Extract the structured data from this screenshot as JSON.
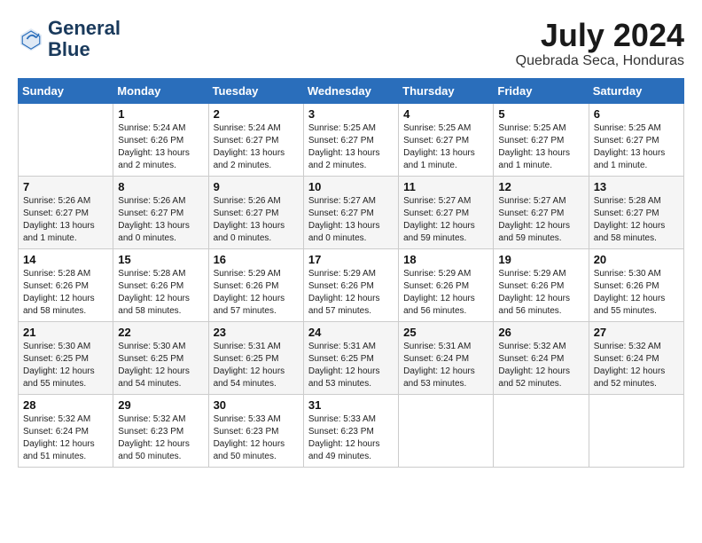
{
  "logo": {
    "line1": "General",
    "line2": "Blue"
  },
  "title": {
    "month_year": "July 2024",
    "location": "Quebrada Seca, Honduras"
  },
  "weekdays": [
    "Sunday",
    "Monday",
    "Tuesday",
    "Wednesday",
    "Thursday",
    "Friday",
    "Saturday"
  ],
  "weeks": [
    [
      {
        "day": "",
        "info": ""
      },
      {
        "day": "1",
        "info": "Sunrise: 5:24 AM\nSunset: 6:26 PM\nDaylight: 13 hours\nand 2 minutes."
      },
      {
        "day": "2",
        "info": "Sunrise: 5:24 AM\nSunset: 6:27 PM\nDaylight: 13 hours\nand 2 minutes."
      },
      {
        "day": "3",
        "info": "Sunrise: 5:25 AM\nSunset: 6:27 PM\nDaylight: 13 hours\nand 2 minutes."
      },
      {
        "day": "4",
        "info": "Sunrise: 5:25 AM\nSunset: 6:27 PM\nDaylight: 13 hours\nand 1 minute."
      },
      {
        "day": "5",
        "info": "Sunrise: 5:25 AM\nSunset: 6:27 PM\nDaylight: 13 hours\nand 1 minute."
      },
      {
        "day": "6",
        "info": "Sunrise: 5:25 AM\nSunset: 6:27 PM\nDaylight: 13 hours\nand 1 minute."
      }
    ],
    [
      {
        "day": "7",
        "info": "Sunrise: 5:26 AM\nSunset: 6:27 PM\nDaylight: 13 hours\nand 1 minute."
      },
      {
        "day": "8",
        "info": "Sunrise: 5:26 AM\nSunset: 6:27 PM\nDaylight: 13 hours\nand 0 minutes."
      },
      {
        "day": "9",
        "info": "Sunrise: 5:26 AM\nSunset: 6:27 PM\nDaylight: 13 hours\nand 0 minutes."
      },
      {
        "day": "10",
        "info": "Sunrise: 5:27 AM\nSunset: 6:27 PM\nDaylight: 13 hours\nand 0 minutes."
      },
      {
        "day": "11",
        "info": "Sunrise: 5:27 AM\nSunset: 6:27 PM\nDaylight: 12 hours\nand 59 minutes."
      },
      {
        "day": "12",
        "info": "Sunrise: 5:27 AM\nSunset: 6:27 PM\nDaylight: 12 hours\nand 59 minutes."
      },
      {
        "day": "13",
        "info": "Sunrise: 5:28 AM\nSunset: 6:27 PM\nDaylight: 12 hours\nand 58 minutes."
      }
    ],
    [
      {
        "day": "14",
        "info": "Sunrise: 5:28 AM\nSunset: 6:26 PM\nDaylight: 12 hours\nand 58 minutes."
      },
      {
        "day": "15",
        "info": "Sunrise: 5:28 AM\nSunset: 6:26 PM\nDaylight: 12 hours\nand 58 minutes."
      },
      {
        "day": "16",
        "info": "Sunrise: 5:29 AM\nSunset: 6:26 PM\nDaylight: 12 hours\nand 57 minutes."
      },
      {
        "day": "17",
        "info": "Sunrise: 5:29 AM\nSunset: 6:26 PM\nDaylight: 12 hours\nand 57 minutes."
      },
      {
        "day": "18",
        "info": "Sunrise: 5:29 AM\nSunset: 6:26 PM\nDaylight: 12 hours\nand 56 minutes."
      },
      {
        "day": "19",
        "info": "Sunrise: 5:29 AM\nSunset: 6:26 PM\nDaylight: 12 hours\nand 56 minutes."
      },
      {
        "day": "20",
        "info": "Sunrise: 5:30 AM\nSunset: 6:26 PM\nDaylight: 12 hours\nand 55 minutes."
      }
    ],
    [
      {
        "day": "21",
        "info": "Sunrise: 5:30 AM\nSunset: 6:25 PM\nDaylight: 12 hours\nand 55 minutes."
      },
      {
        "day": "22",
        "info": "Sunrise: 5:30 AM\nSunset: 6:25 PM\nDaylight: 12 hours\nand 54 minutes."
      },
      {
        "day": "23",
        "info": "Sunrise: 5:31 AM\nSunset: 6:25 PM\nDaylight: 12 hours\nand 54 minutes."
      },
      {
        "day": "24",
        "info": "Sunrise: 5:31 AM\nSunset: 6:25 PM\nDaylight: 12 hours\nand 53 minutes."
      },
      {
        "day": "25",
        "info": "Sunrise: 5:31 AM\nSunset: 6:24 PM\nDaylight: 12 hours\nand 53 minutes."
      },
      {
        "day": "26",
        "info": "Sunrise: 5:32 AM\nSunset: 6:24 PM\nDaylight: 12 hours\nand 52 minutes."
      },
      {
        "day": "27",
        "info": "Sunrise: 5:32 AM\nSunset: 6:24 PM\nDaylight: 12 hours\nand 52 minutes."
      }
    ],
    [
      {
        "day": "28",
        "info": "Sunrise: 5:32 AM\nSunset: 6:24 PM\nDaylight: 12 hours\nand 51 minutes."
      },
      {
        "day": "29",
        "info": "Sunrise: 5:32 AM\nSunset: 6:23 PM\nDaylight: 12 hours\nand 50 minutes."
      },
      {
        "day": "30",
        "info": "Sunrise: 5:33 AM\nSunset: 6:23 PM\nDaylight: 12 hours\nand 50 minutes."
      },
      {
        "day": "31",
        "info": "Sunrise: 5:33 AM\nSunset: 6:23 PM\nDaylight: 12 hours\nand 49 minutes."
      },
      {
        "day": "",
        "info": ""
      },
      {
        "day": "",
        "info": ""
      },
      {
        "day": "",
        "info": ""
      }
    ]
  ]
}
